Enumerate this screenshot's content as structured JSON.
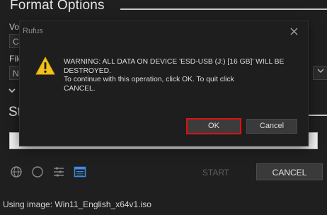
{
  "background": {
    "section_title": "Format Options",
    "volume_label": "Vol",
    "volume_value": "C",
    "file_label": "File",
    "file_value": "NT",
    "status_heading": "St",
    "start_label": "START",
    "cancel_label": "CANCEL",
    "status_line": "Using image: Win11_English_x64v1.iso"
  },
  "dialog": {
    "title": "Rufus",
    "warning_line1": "WARNING: ALL DATA ON DEVICE 'ESD-USB (J:) [16 GB]' WILL BE",
    "warning_line2": "DESTROYED.",
    "instruction_line1": "To continue with this operation, click OK. To quit click",
    "instruction_line2": "CANCEL.",
    "ok_label": "OK",
    "cancel_label": "Cancel"
  },
  "colors": {
    "accent_red": "#e01010",
    "warning_yellow": "#f3c21b",
    "background": "#1f1f1f"
  }
}
